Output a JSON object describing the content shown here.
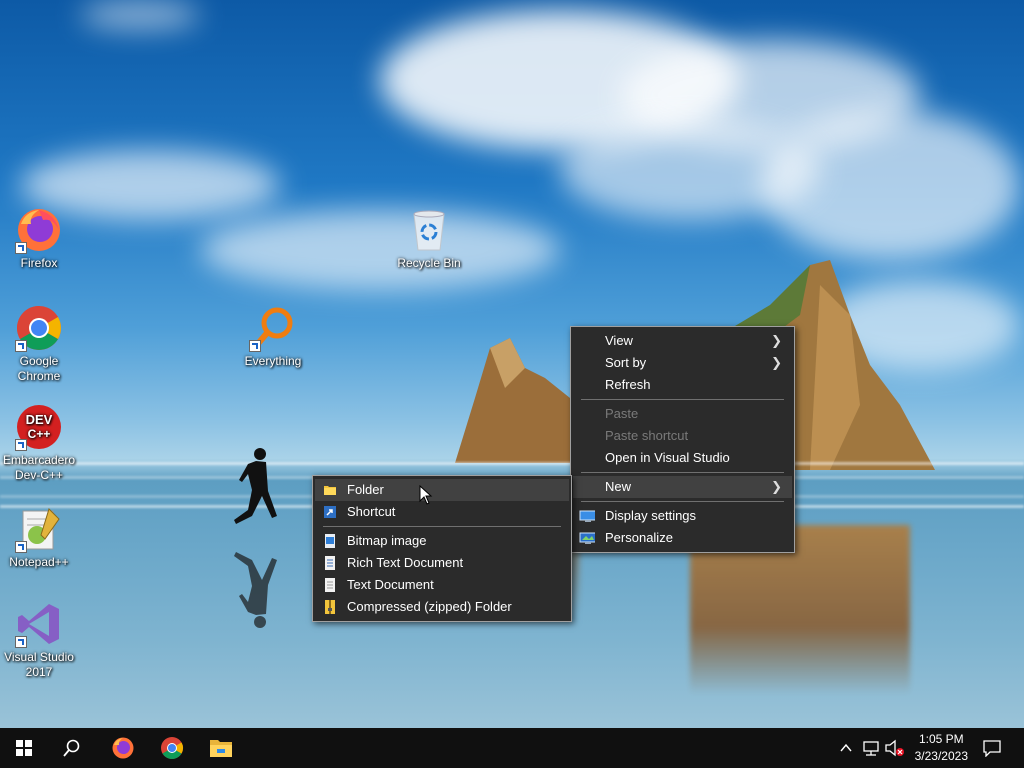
{
  "desktop": {
    "icons": [
      {
        "label": "Firefox",
        "icon": "firefox-icon"
      },
      {
        "label": "Google Chrome",
        "icon": "chrome-icon"
      },
      {
        "label": "Embarcadero Dev-C++",
        "icon": "devcpp-icon"
      },
      {
        "label": "Notepad++",
        "icon": "notepadpp-icon"
      },
      {
        "label": "Visual Studio 2017",
        "icon": "visual-studio-icon"
      },
      {
        "label": "Recycle Bin",
        "icon": "recycle-bin-icon"
      },
      {
        "label": "Everything",
        "icon": "everything-search-icon"
      }
    ]
  },
  "context_menu": {
    "items": {
      "view": "View",
      "sort_by": "Sort by",
      "refresh": "Refresh",
      "paste": "Paste",
      "paste_shortcut": "Paste shortcut",
      "open_vs": "Open in Visual Studio",
      "new": "New",
      "display_settings": "Display settings",
      "personalize": "Personalize"
    }
  },
  "new_submenu": {
    "items": {
      "folder": "Folder",
      "shortcut": "Shortcut",
      "bitmap": "Bitmap image",
      "rtf": "Rich Text Document",
      "text": "Text Document",
      "zip": "Compressed (zipped) Folder"
    }
  },
  "taskbar": {
    "time": "1:05 PM",
    "date": "3/23/2023"
  },
  "colors": {
    "menu_bg": "#2b2b2b",
    "menu_hover": "#414141",
    "taskbar_bg": "#101010",
    "accent": "#76b9ed"
  }
}
